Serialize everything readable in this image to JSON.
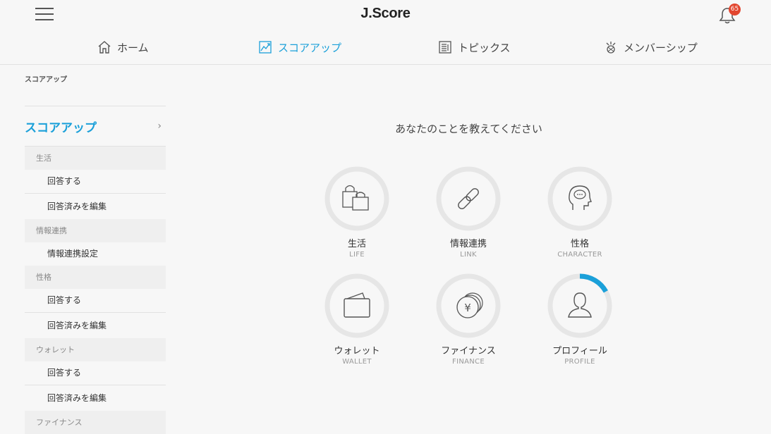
{
  "header": {
    "logo": "J.Score",
    "notification_count": "65"
  },
  "nav": {
    "tabs": [
      {
        "label": "ホーム",
        "icon": "home-icon",
        "active": false
      },
      {
        "label": "スコアアップ",
        "icon": "chart-up-icon",
        "active": true
      },
      {
        "label": "トピックス",
        "icon": "document-icon",
        "active": false
      },
      {
        "label": "メンバーシップ",
        "icon": "membership-icon",
        "active": false
      }
    ]
  },
  "breadcrumb": "スコアアップ",
  "sidebar": {
    "title": "スコアアップ",
    "sections": [
      {
        "label": "生活",
        "items": [
          "回答する",
          "回答済みを編集"
        ]
      },
      {
        "label": "情報連携",
        "items": [
          "情報連携設定"
        ]
      },
      {
        "label": "性格",
        "items": [
          "回答する",
          "回答済みを編集"
        ]
      },
      {
        "label": "ウォレット",
        "items": [
          "回答する",
          "回答済みを編集"
        ]
      },
      {
        "label": "ファイナンス",
        "items": []
      }
    ]
  },
  "main": {
    "heading": "あなたのことを教えてください",
    "categories": [
      {
        "jp": "生活",
        "en": "LIFE",
        "icon": "shopping-bags-icon",
        "progress": 0
      },
      {
        "jp": "情報連携",
        "en": "LINK",
        "icon": "link-icon",
        "progress": 0
      },
      {
        "jp": "性格",
        "en": "CHARACTER",
        "icon": "head-icon",
        "progress": 0
      },
      {
        "jp": "ウォレット",
        "en": "WALLET",
        "icon": "wallet-icon",
        "progress": 0
      },
      {
        "jp": "ファイナンス",
        "en": "FINANCE",
        "icon": "yen-coins-icon",
        "progress": 0
      },
      {
        "jp": "プロフィール",
        "en": "PROFILE",
        "icon": "person-icon",
        "progress": 0.17
      }
    ]
  },
  "colors": {
    "accent": "#1ba0d9",
    "ring_track": "#e6e6e6",
    "badge": "#e2462f",
    "background": "#f7f7f7"
  }
}
